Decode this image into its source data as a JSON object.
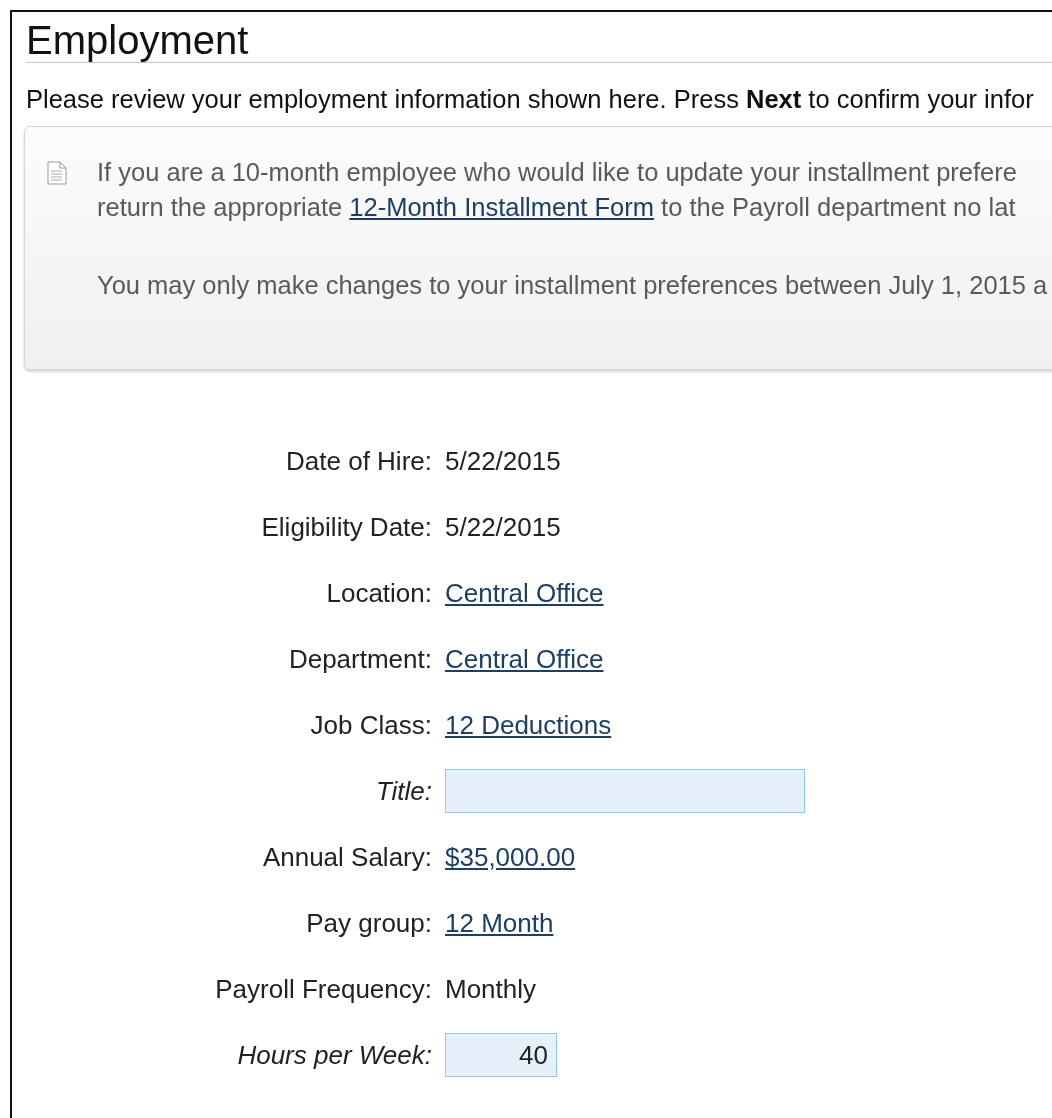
{
  "title": "Employment",
  "intro": "Please review your employment information shown here. Press **Next** to confirm your infor",
  "notice": {
    "paragraphs": [
      [
        {
          "before": "If you are a 10-month employee who would like to update your installment prefere"
        },
        {
          "before": "return the appropriate ",
          "link": "12-Month Installment Form",
          "after": " to the Payroll department no lat"
        }
      ],
      [
        {
          "before": "You may only make changes to your installment preferences between July 1, 2015 a"
        }
      ]
    ]
  },
  "fields": [
    {
      "kind": "text",
      "label": "Date of Hire:",
      "value": "5/22/2015"
    },
    {
      "kind": "text",
      "label": "Eligibility Date:",
      "value": "5/22/2015"
    },
    {
      "kind": "link",
      "label": "Location:",
      "value": "Central Office"
    },
    {
      "kind": "link",
      "label": "Department:",
      "value": "Central Office"
    },
    {
      "kind": "link",
      "label": "Job Class:",
      "value": "12 Deductions"
    },
    {
      "kind": "input",
      "label": "Title:"
    },
    {
      "kind": "link",
      "label": "Annual Salary:",
      "value": "$35,000.00"
    },
    {
      "kind": "link",
      "label": "Pay group:",
      "value": "12 Month"
    },
    {
      "kind": "text",
      "label": "Payroll Frequency:",
      "value": "Monthly"
    },
    {
      "kind": "input",
      "label": "Hours per Week:",
      "value": "40"
    }
  ]
}
